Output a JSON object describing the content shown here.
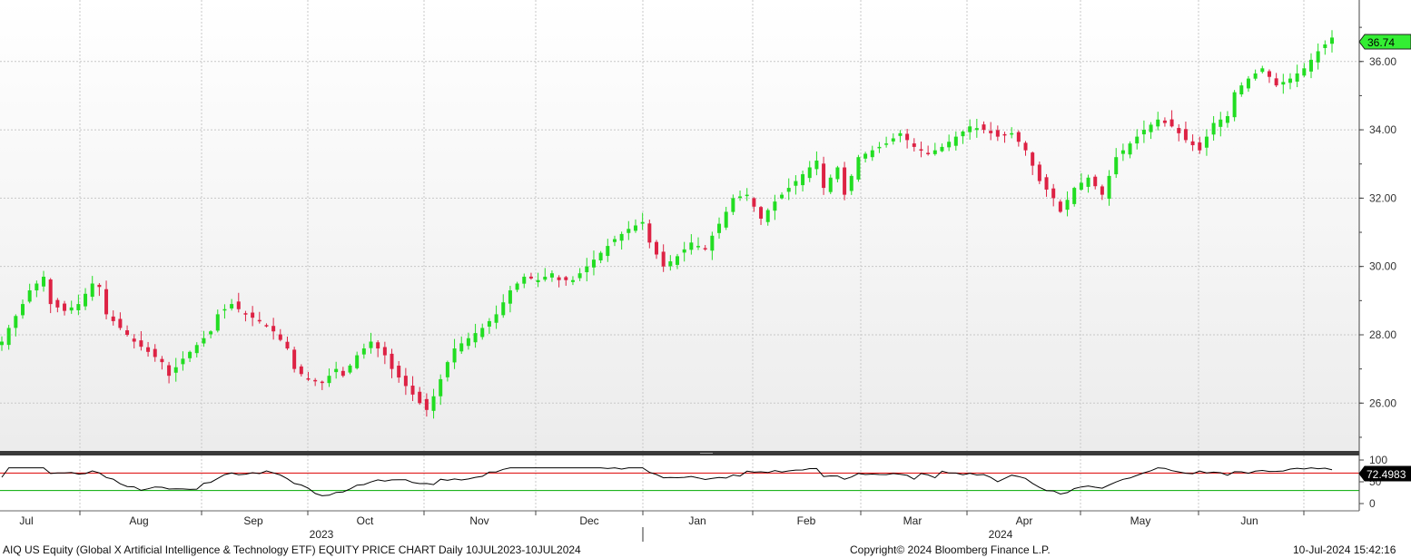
{
  "footer": {
    "left": "AIQ US Equity (Global X Artificial Intelligence & Technology ETF) EQUITY PRICE CHART  Daily 10JUL2023-10JUL2024",
    "center": "Copyright© 2024 Bloomberg Finance L.P.",
    "right": "10-Jul-2024 15:42:16"
  },
  "colors": {
    "up": "#22dd22",
    "down": "#dd2244",
    "last_tag": "#33ee33",
    "rsi_upper_line": "#dd0000",
    "rsi_lower_line": "#00aa00",
    "rsi_line": "#000000",
    "grid": "#c8c8c8"
  },
  "chart_data": [
    {
      "type": "candlestick",
      "title": "",
      "ylim": [
        24.6,
        37.8
      ],
      "y_ticks": [
        "26.00",
        "28.00",
        "30.00",
        "32.00",
        "34.00",
        "36.00"
      ],
      "y_tick_values": [
        26,
        28,
        30,
        32,
        34,
        36
      ],
      "last_value": "36.74",
      "x_month_labels": [
        "Jul",
        "Aug",
        "Sep",
        "Oct",
        "Nov",
        "Dec",
        "Jan",
        "Feb",
        "Mar",
        "Apr",
        "May",
        "Jun"
      ],
      "x_year_labels": [
        "2023",
        "2024"
      ],
      "grid": true,
      "close_points_by_weekday_index": [
        [
          0,
          27.8
        ],
        [
          1,
          28.2
        ],
        [
          3,
          28.9
        ],
        [
          4,
          29.3
        ],
        [
          6,
          29.7
        ],
        [
          7,
          28.9
        ],
        [
          9,
          28.7
        ],
        [
          11,
          28.9
        ],
        [
          13,
          29.5
        ],
        [
          14,
          29.4
        ],
        [
          15,
          28.6
        ],
        [
          17,
          28.2
        ],
        [
          19,
          27.8
        ],
        [
          21,
          27.5
        ],
        [
          23,
          27.2
        ],
        [
          24,
          26.8
        ],
        [
          26,
          27.3
        ],
        [
          28,
          27.7
        ],
        [
          30,
          28.1
        ],
        [
          31,
          28.6
        ],
        [
          33,
          28.9
        ],
        [
          35,
          28.6
        ],
        [
          37,
          28.4
        ],
        [
          39,
          28.1
        ],
        [
          41,
          27.6
        ],
        [
          42,
          27.0
        ],
        [
          44,
          26.7
        ],
        [
          46,
          26.6
        ],
        [
          48,
          27.0
        ],
        [
          49,
          26.8
        ],
        [
          51,
          27.4
        ],
        [
          53,
          27.8
        ],
        [
          55,
          27.4
        ],
        [
          56,
          27.0
        ],
        [
          58,
          26.5
        ],
        [
          60,
          26.0
        ],
        [
          61,
          25.8
        ],
        [
          62,
          26.2
        ],
        [
          64,
          27.2
        ],
        [
          65,
          27.6
        ],
        [
          67,
          27.9
        ],
        [
          69,
          28.2
        ],
        [
          71,
          28.6
        ],
        [
          73,
          29.3
        ],
        [
          75,
          29.7
        ],
        [
          77,
          29.6
        ],
        [
          79,
          29.8
        ],
        [
          80,
          29.6
        ],
        [
          82,
          29.6
        ],
        [
          84,
          30.0
        ],
        [
          86,
          30.4
        ],
        [
          88,
          30.8
        ],
        [
          90,
          31.1
        ],
        [
          92,
          31.3
        ],
        [
          93,
          30.7
        ],
        [
          95,
          30.0
        ],
        [
          97,
          30.3
        ],
        [
          99,
          30.7
        ],
        [
          101,
          30.5
        ],
        [
          102,
          30.9
        ],
        [
          104,
          31.6
        ],
        [
          105,
          32.0
        ],
        [
          107,
          32.1
        ],
        [
          109,
          31.4
        ],
        [
          111,
          31.9
        ],
        [
          113,
          32.3
        ],
        [
          115,
          32.7
        ],
        [
          117,
          33.1
        ],
        [
          118,
          32.3
        ],
        [
          120,
          32.9
        ],
        [
          121,
          32.1
        ],
        [
          123,
          33.2
        ],
        [
          125,
          33.4
        ],
        [
          127,
          33.6
        ],
        [
          129,
          33.9
        ],
        [
          131,
          33.5
        ],
        [
          133,
          33.3
        ],
        [
          135,
          33.5
        ],
        [
          137,
          33.8
        ],
        [
          139,
          34.1
        ],
        [
          141,
          34.0
        ],
        [
          143,
          33.8
        ],
        [
          145,
          33.9
        ],
        [
          147,
          33.4
        ],
        [
          149,
          32.5
        ],
        [
          151,
          32.0
        ],
        [
          152,
          31.6
        ],
        [
          154,
          32.3
        ],
        [
          156,
          32.6
        ],
        [
          158,
          32.1
        ],
        [
          160,
          33.2
        ],
        [
          162,
          33.6
        ],
        [
          164,
          34.0
        ],
        [
          166,
          34.3
        ],
        [
          168,
          34.1
        ],
        [
          170,
          33.7
        ],
        [
          172,
          33.4
        ],
        [
          174,
          34.2
        ],
        [
          176,
          34.4
        ],
        [
          177,
          35.1
        ],
        [
          179,
          35.5
        ],
        [
          181,
          35.8
        ],
        [
          183,
          35.3
        ],
        [
          185,
          35.5
        ],
        [
          187,
          35.8
        ],
        [
          189,
          36.3
        ],
        [
          191,
          36.7
        ]
      ]
    },
    {
      "type": "line",
      "title": "",
      "last_value": "72.4983",
      "ylim": [
        0,
        100
      ],
      "y_ticks": [
        "100",
        "50",
        "0"
      ],
      "y_tick_values": [
        100,
        50,
        0
      ],
      "upper_level": 70,
      "lower_level": 30,
      "grid": true
    }
  ]
}
